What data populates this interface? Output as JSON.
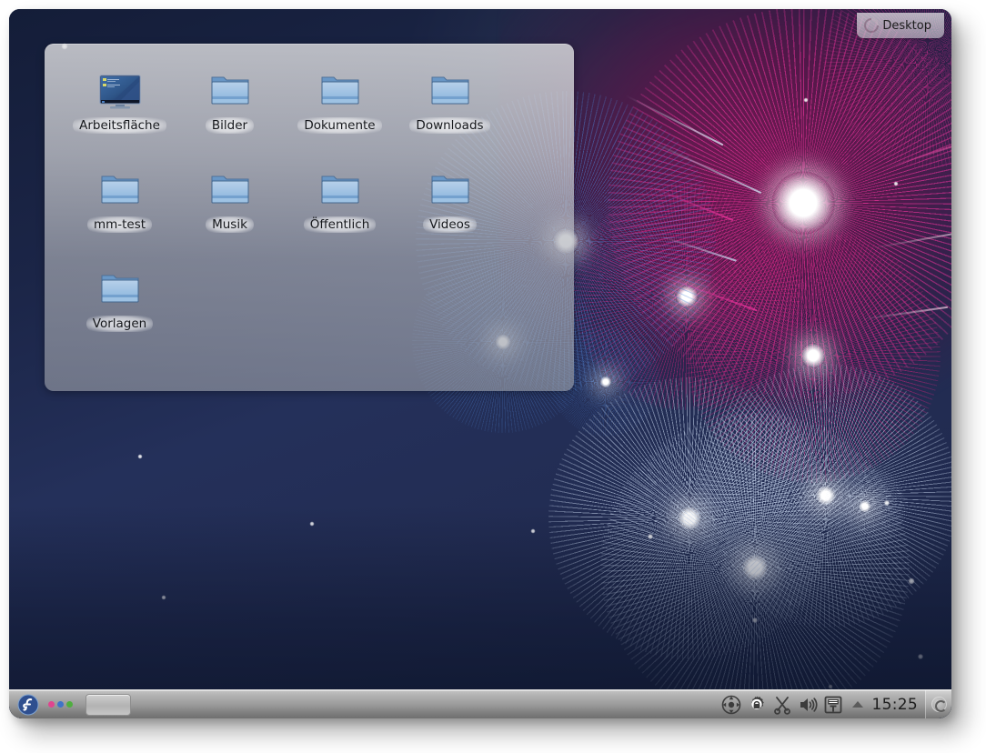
{
  "desktop": {
    "toolbox_label": "Desktop",
    "toolbox_icon": "cashew-toolbox-icon"
  },
  "folder_view": {
    "icons": [
      {
        "label": "Arbeitsfläche",
        "icon": "desktop-preview-icon"
      },
      {
        "label": "Bilder",
        "icon": "folder-icon"
      },
      {
        "label": "Dokumente",
        "icon": "folder-icon"
      },
      {
        "label": "Downloads",
        "icon": "folder-icon"
      },
      {
        "label": "mm-test",
        "icon": "folder-icon"
      },
      {
        "label": "Musik",
        "icon": "folder-icon"
      },
      {
        "label": "Öffentlich",
        "icon": "folder-icon"
      },
      {
        "label": "Videos",
        "icon": "folder-icon"
      },
      {
        "label": "Vorlagen",
        "icon": "folder-icon"
      }
    ]
  },
  "panel": {
    "launcher": {
      "name": "fedora-menu-icon",
      "label": "Fedora"
    },
    "pager": {
      "name": "pager-icon",
      "dots": [
        "#e0448f",
        "#3f73c8",
        "#4fae3f"
      ]
    },
    "tasks": [
      {
        "name": "task-window-button",
        "label": ""
      }
    ],
    "systray": [
      {
        "name": "network-manager-icon",
        "label": "Netzwerk"
      },
      {
        "name": "selinux-gear-lock-icon",
        "label": "SELinux"
      },
      {
        "name": "klipper-scissors-icon",
        "label": "Klipper"
      },
      {
        "name": "volume-speaker-icon",
        "label": "Lautstärke"
      },
      {
        "name": "device-notifier-icon",
        "label": "Gerätebenachrichtigung"
      }
    ],
    "tray_arrow": {
      "name": "show-hidden-tray-icons-icon",
      "label": "▲"
    },
    "clock": "15:25",
    "cashew": {
      "name": "panel-toolbox-icon",
      "label": "Einstellungen"
    }
  },
  "colors": {
    "panel_top": "#c3c3c3",
    "panel_bottom": "#6f6f6f",
    "wallpaper_navy": "#1b2547",
    "wallpaper_magenta": "#d4257f",
    "folder_blue": "#7fa7d8",
    "accent_fedora": "#2f4f8f"
  }
}
